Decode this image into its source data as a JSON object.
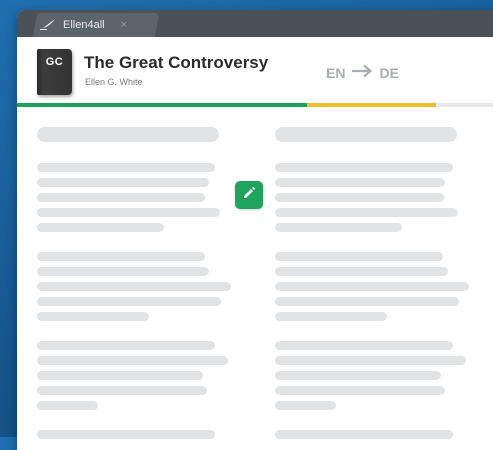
{
  "tab": {
    "label": "Ellen4all",
    "close": "×"
  },
  "book": {
    "abbrev": "GC",
    "title": "The Great Controversy",
    "author": "Ellen G. White"
  },
  "languages": {
    "source": "EN",
    "target": "DE"
  },
  "progress": {
    "completed_fraction": 0.61,
    "review_fraction": 0.27
  },
  "colors": {
    "green": "#21a05a",
    "yellow": "#f2bd2c",
    "tabbar": "#4a5159",
    "background": "#1a64a3"
  },
  "icons": {
    "tab": "quill-icon",
    "arrow": "arrow-right-icon",
    "edit": "pencil-icon"
  }
}
